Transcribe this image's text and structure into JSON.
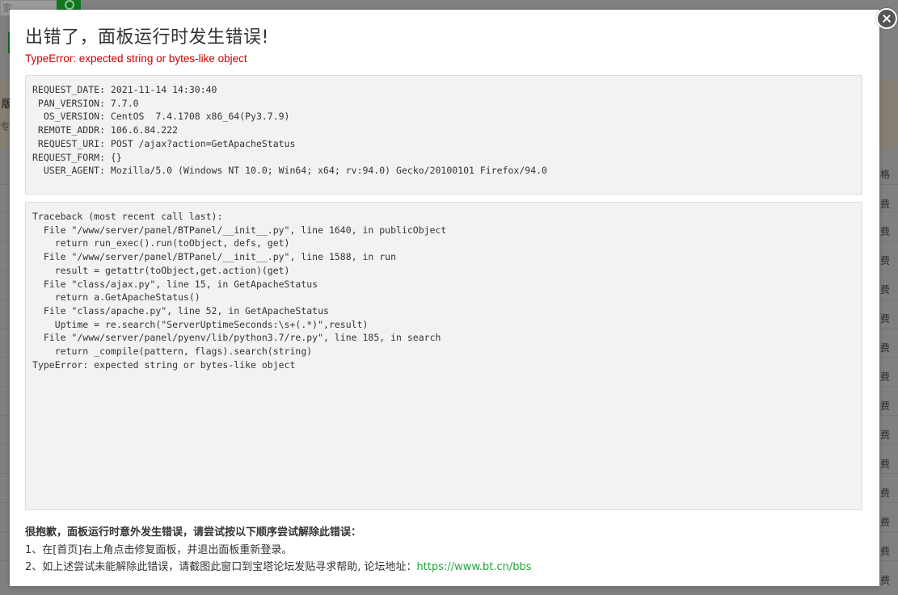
{
  "background": {
    "search_text": "索",
    "notice_title": "版",
    "notice_text": "专业",
    "right_column_header": "格",
    "right_column_items": [
      "费",
      "费",
      "费",
      "费",
      "费",
      "费",
      "费",
      "费",
      "费",
      "费",
      "费",
      "费",
      "费",
      "费"
    ]
  },
  "modal": {
    "title": "出错了，面板运行时发生错误!",
    "error_message": "TypeError: expected string or bytes-like object",
    "request_info": [
      "REQUEST_DATE: 2021-11-14 14:30:40",
      " PAN_VERSION: 7.7.0",
      "  OS_VERSION: CentOS  7.4.1708 x86_64(Py3.7.9)",
      " REMOTE_ADDR: 106.6.84.222",
      " REQUEST_URI: POST /ajax?action=GetApacheStatus",
      "REQUEST_FORM: {}",
      "  USER_AGENT: Mozilla/5.0 (Windows NT 10.0; Win64; x64; rv:94.0) Gecko/20100101 Firefox/94.0"
    ],
    "traceback": [
      "Traceback (most recent call last):",
      "  File \"/www/server/panel/BTPanel/__init__.py\", line 1640, in publicObject",
      "    return run_exec().run(toObject, defs, get)",
      "  File \"/www/server/panel/BTPanel/__init__.py\", line 1588, in run",
      "    result = getattr(toObject,get.action)(get)",
      "  File \"class/ajax.py\", line 15, in GetApacheStatus",
      "    return a.GetApacheStatus()",
      "  File \"class/apache.py\", line 52, in GetApacheStatus",
      "    Uptime = re.search(\"ServerUptimeSeconds:\\s+(.*)\",result)",
      "  File \"/www/server/panel/pyenv/lib/python3.7/re.py\", line 185, in search",
      "    return _compile(pattern, flags).search(string)",
      "TypeError: expected string or bytes-like object"
    ],
    "help_title": "很抱歉，面板运行时意外发生错误，请尝试按以下顺序尝试解除此错误：",
    "help_step_1": "1、在[首页]右上角点击修复面板，并退出面板重新登录。",
    "help_step_2_prefix": "2、如上述尝试未能解除此错误，请截图此窗口到宝塔论坛发贴寻求帮助, 论坛地址：",
    "help_step_2_link": "https://www.bt.cn/bbs",
    "close_icon": "close-icon"
  },
  "colors": {
    "error_red": "#cc0000",
    "link_green": "#20a53a",
    "overlay": "#808080"
  }
}
